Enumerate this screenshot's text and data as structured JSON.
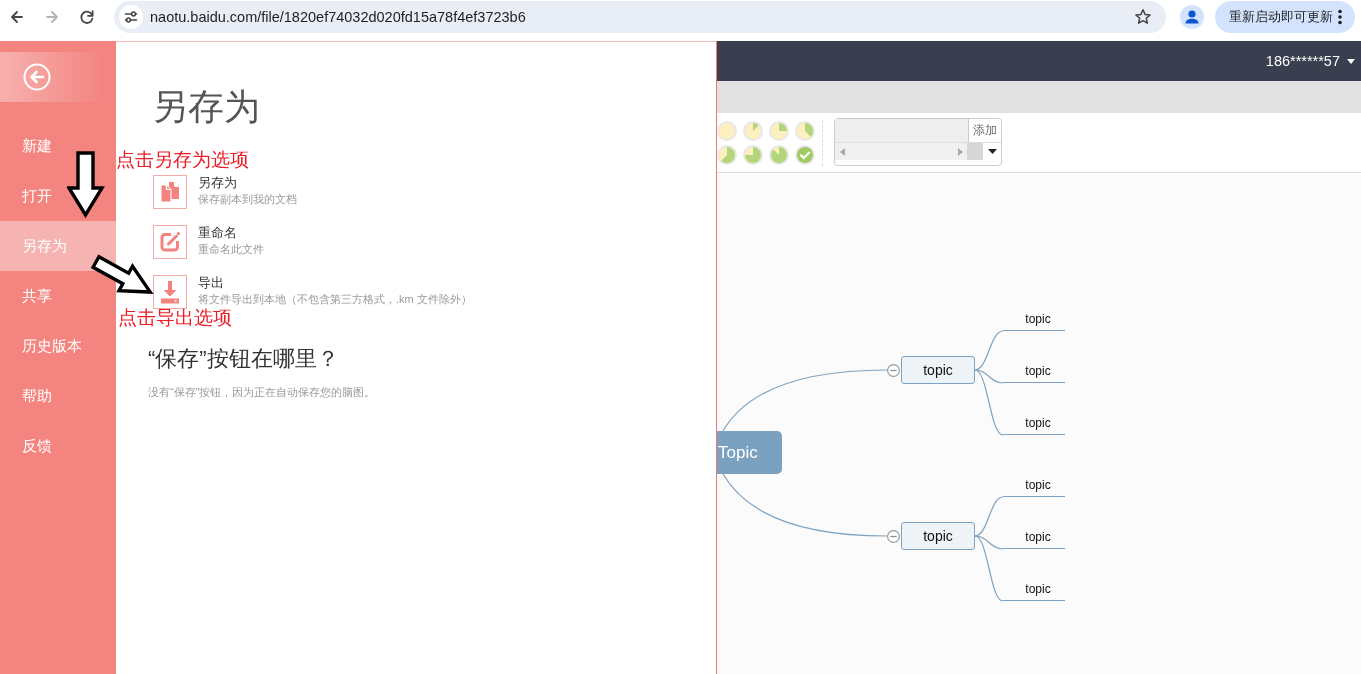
{
  "browser": {
    "nav_buttons": [
      {
        "kind": "back",
        "disabled": false
      },
      {
        "kind": "forward",
        "disabled": true
      },
      {
        "kind": "reload",
        "disabled": false
      }
    ],
    "url": "naotu.baidu.com/file/1820ef74032d020fd15a78f4ef3723b6",
    "update_button": "重新启动即可更新"
  },
  "sidebar": {
    "items": [
      {
        "label": "新建",
        "selected": false
      },
      {
        "label": "打开",
        "selected": false
      },
      {
        "label": "另存为",
        "selected": true
      },
      {
        "label": "共享",
        "selected": false
      },
      {
        "label": "历史版本",
        "selected": false
      },
      {
        "label": "帮助",
        "selected": false
      },
      {
        "label": "反馈",
        "selected": false
      }
    ]
  },
  "panel": {
    "title": "另存为",
    "options": [
      {
        "kind": "copy",
        "title": "另存为",
        "description": "保存副本到我的文档"
      },
      {
        "kind": "rename",
        "title": "重命名",
        "description": "重命名此文件"
      },
      {
        "kind": "export",
        "title": "导出",
        "description": "将文件导出到本地（不包含第三方格式，.km 文件除外）"
      }
    ],
    "faq_title": "“保存”按钮在哪里？",
    "faq_text": "没有“保存”按钮，因为正在自动保存您的脑图。"
  },
  "annotations": [
    {
      "text": "点击另存为选项"
    },
    {
      "text": "点击导出选项"
    }
  ],
  "header": {
    "user": "186******57"
  },
  "toolbar": {
    "progress_icons": [
      {
        "kind": "empty"
      },
      {
        "kind": "eighth"
      },
      {
        "kind": "quarter"
      },
      {
        "kind": "three-eighths"
      },
      {
        "kind": "five-eighths"
      },
      {
        "kind": "three-quarters"
      },
      {
        "kind": "seven-eighths"
      },
      {
        "kind": "done"
      }
    ],
    "resource_button": "添加"
  },
  "mindmap": {
    "root": "Topic",
    "children": [
      {
        "label": "topic",
        "expanded": true,
        "children": [
          {
            "label": "topic"
          },
          {
            "label": "topic"
          },
          {
            "label": "topic"
          }
        ]
      },
      {
        "label": "topic",
        "expanded": true,
        "children": [
          {
            "label": "topic"
          },
          {
            "label": "topic"
          },
          {
            "label": "topic"
          }
        ]
      }
    ]
  }
}
